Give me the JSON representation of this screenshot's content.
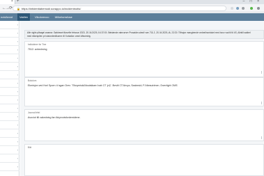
{
  "browser": {
    "tab_close": "×",
    "new_tab": "+",
    "window_controls": "– □ ×",
    "back": "←",
    "forward": "→",
    "reload": "⟳",
    "lock": "🔒",
    "url": "https://intidentiabemodi.sorappo.io/incidentnotis/"
  },
  "navbar": {
    "brand": "ncidAvvot",
    "tabs": [
      {
        "label": "Vakfen",
        "active": true
      },
      {
        "label": "Vikolomvoo"
      },
      {
        "label": "Miikelsmsfuse"
      }
    ]
  },
  "sidebar": {
    "chevron": "›"
  },
  "main": {
    "info_line1": "Alle vigile pårøgel ananse. Søkbeset tilvuefle febvuar 2023, 20.16.2025, 04:37:00. Belstende ratevurver Prosalde udesif rum 731.2, 20.16.2025, AL 22:23: Tilfrajon mangbende vednelinontokel med bovv vad til til 4S, Alintill sakbel",
    "info_line2": "med ekkespilen pri sistorderdikomm til Vurkalion omnt Afbomkrig.",
    "panels": [
      {
        "label": "Indluidmer for Tine",
        "text": "7512: avbedming"
      },
      {
        "label": "Bokolom",
        "text": "Ekmisjon ved Horl Sporn •\\l sgan Grev: \"Ekvymiski/Abudsikam Ivah CT (vi)\". Bevitt CT/Arvyo; Sasbeski; P-Nbesutrimer; Overrlight OMS"
      },
      {
        "label": "Journal fefel",
        "text": "Avoviot till vakedning fan Ikkyrvotsfordemidene."
      },
      {
        "label": "Bild",
        "text": ""
      }
    ]
  },
  "colors": {
    "navbar": "#5b7e9a",
    "navbar_active": "#2d5777",
    "background": "#f4f6f8"
  }
}
